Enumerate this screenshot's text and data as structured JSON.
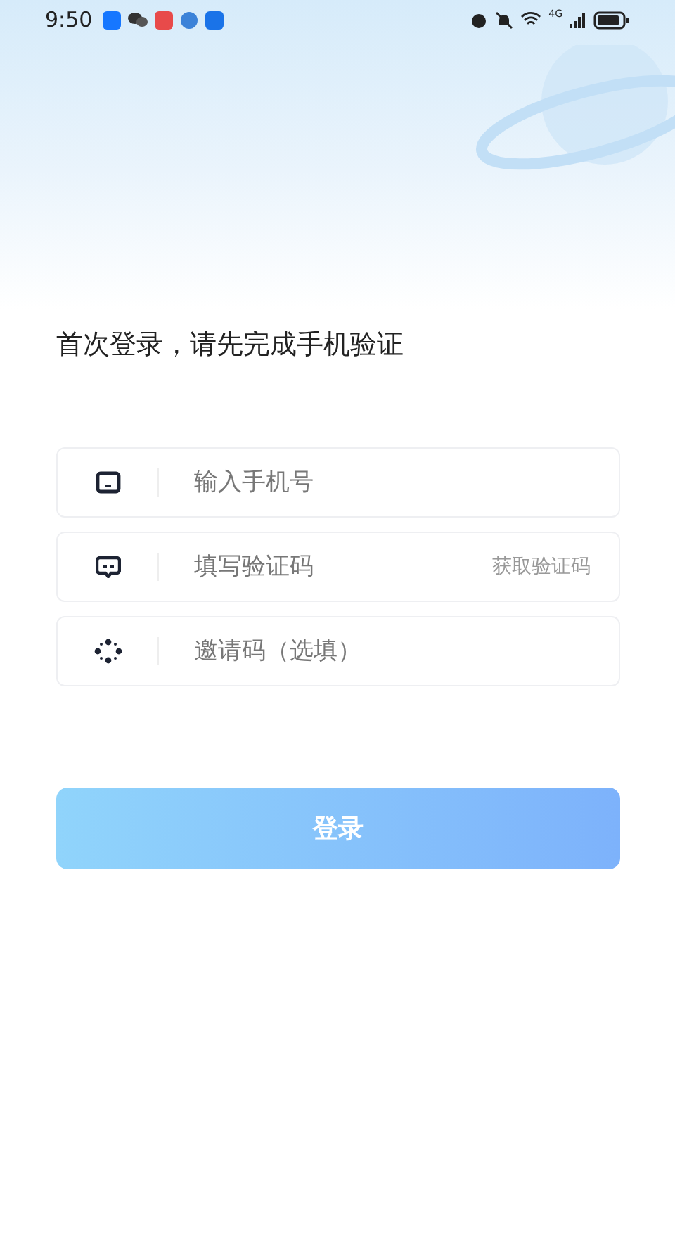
{
  "status_bar": {
    "time": "9:50",
    "network": "4G"
  },
  "heading": "首次登录，请先完成手机验证",
  "fields": [
    {
      "kind": "phone",
      "placeholder": "输入手机号"
    },
    {
      "kind": "code",
      "placeholder": "填写验证码",
      "action": "获取验证码"
    },
    {
      "kind": "invite",
      "placeholder": "邀请码（选填）"
    }
  ],
  "login_button": {
    "label": "登录",
    "disabled": true
  }
}
